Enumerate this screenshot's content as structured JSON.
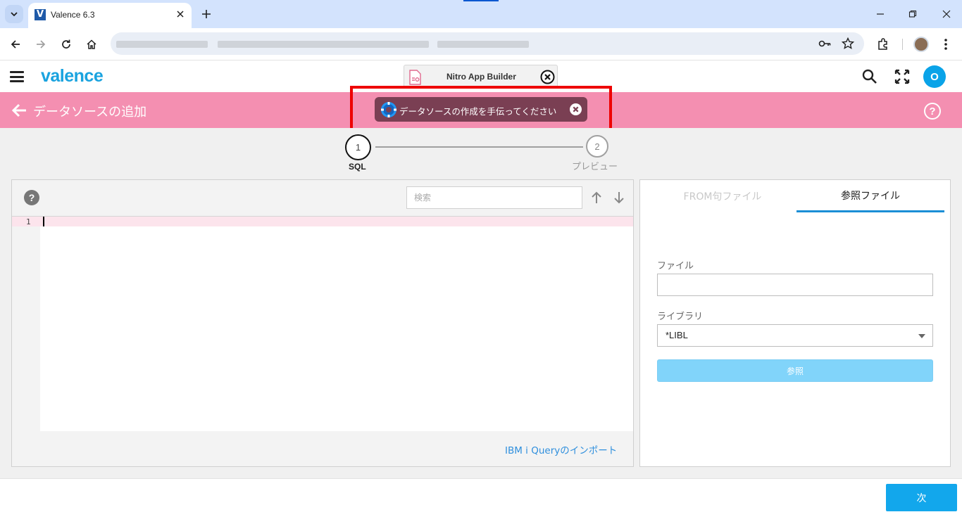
{
  "browser": {
    "tab_title": "Valence 6.3",
    "favicon_letter": "V"
  },
  "app": {
    "logo": "valence",
    "nitro_tab_label": "Nitro App Builder",
    "user_initial": "O"
  },
  "titlebar": {
    "title": "データソースの追加",
    "assist_label": "データソースの作成を手伝ってください",
    "help_glyph": "?"
  },
  "stepper": {
    "steps": [
      {
        "number": "1",
        "label": "SQL",
        "active": true
      },
      {
        "number": "2",
        "label": "プレビュー",
        "active": false
      }
    ]
  },
  "editor": {
    "help_glyph": "?",
    "search_placeholder": "検索",
    "line_number": "1",
    "import_link": "IBM i Queryのインポート"
  },
  "side_panel": {
    "tabs": [
      {
        "label": "FROM句ファイル",
        "active": false
      },
      {
        "label": "参照ファイル",
        "active": true
      }
    ],
    "file_label": "ファイル",
    "file_value": "",
    "library_label": "ライブラリ",
    "library_value": "*LIBL",
    "browse_button": "参照"
  },
  "footer": {
    "next_button": "次"
  },
  "colors": {
    "titlebar": "#f48fb1",
    "assist_pill": "#7a3f53",
    "accent": "#12a7ec",
    "highlight": "#ee0000"
  }
}
